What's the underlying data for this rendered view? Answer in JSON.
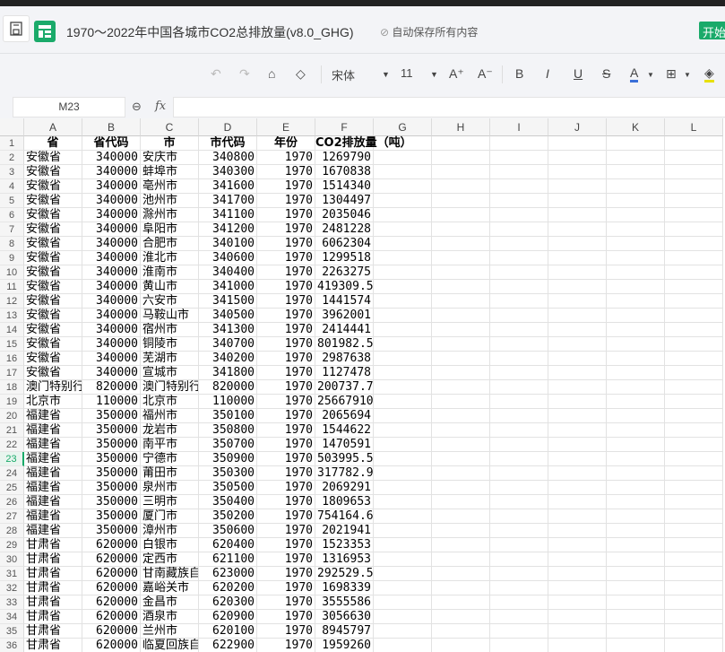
{
  "app": {
    "title": "1970～2022年中国各城市CO2总排放量(v8.0_GHG)",
    "autosave": "自动保存所有内容",
    "start_button": "开始",
    "accent": "#1aaa6a"
  },
  "toolbar": {
    "font_name": "宋体",
    "font_size": "11",
    "bold": "B",
    "italic": "I",
    "underline": "U",
    "strike": "S",
    "font_color": "A",
    "increase_font": "A⁺",
    "decrease_font": "A⁻"
  },
  "formula_bar": {
    "cell_ref": "M23",
    "fx": "fx",
    "value": ""
  },
  "sheet": {
    "columns": [
      "A",
      "B",
      "C",
      "D",
      "E",
      "F",
      "G",
      "H",
      "I",
      "J",
      "K",
      "L"
    ],
    "selected_row": 23,
    "header": [
      "省",
      "省代码",
      "市",
      "市代码",
      "年份",
      "CO2排放量（吨）"
    ],
    "rows": [
      [
        "安徽省",
        "340000",
        "安庆市",
        "340800",
        "1970",
        "1269790"
      ],
      [
        "安徽省",
        "340000",
        "蚌埠市",
        "340300",
        "1970",
        "1670838"
      ],
      [
        "安徽省",
        "340000",
        "亳州市",
        "341600",
        "1970",
        "1514340"
      ],
      [
        "安徽省",
        "340000",
        "池州市",
        "341700",
        "1970",
        "1304497"
      ],
      [
        "安徽省",
        "340000",
        "滁州市",
        "341100",
        "1970",
        "2035046"
      ],
      [
        "安徽省",
        "340000",
        "阜阳市",
        "341200",
        "1970",
        "2481228"
      ],
      [
        "安徽省",
        "340000",
        "合肥市",
        "340100",
        "1970",
        "6062304"
      ],
      [
        "安徽省",
        "340000",
        "淮北市",
        "340600",
        "1970",
        "1299518"
      ],
      [
        "安徽省",
        "340000",
        "淮南市",
        "340400",
        "1970",
        "2263275"
      ],
      [
        "安徽省",
        "340000",
        "黄山市",
        "341000",
        "1970",
        "419309.5"
      ],
      [
        "安徽省",
        "340000",
        "六安市",
        "341500",
        "1970",
        "1441574"
      ],
      [
        "安徽省",
        "340000",
        "马鞍山市",
        "340500",
        "1970",
        "3962001"
      ],
      [
        "安徽省",
        "340000",
        "宿州市",
        "341300",
        "1970",
        "2414441"
      ],
      [
        "安徽省",
        "340000",
        "铜陵市",
        "340700",
        "1970",
        "801982.5"
      ],
      [
        "安徽省",
        "340000",
        "芜湖市",
        "340200",
        "1970",
        "2987638"
      ],
      [
        "安徽省",
        "340000",
        "宣城市",
        "341800",
        "1970",
        "1127478"
      ],
      [
        "澳门特别行",
        "820000",
        "澳门特别行",
        "820000",
        "1970",
        "200737.7"
      ],
      [
        "北京市",
        "110000",
        "北京市",
        "110000",
        "1970",
        "25667910"
      ],
      [
        "福建省",
        "350000",
        "福州市",
        "350100",
        "1970",
        "2065694"
      ],
      [
        "福建省",
        "350000",
        "龙岩市",
        "350800",
        "1970",
        "1544622"
      ],
      [
        "福建省",
        "350000",
        "南平市",
        "350700",
        "1970",
        "1470591"
      ],
      [
        "福建省",
        "350000",
        "宁德市",
        "350900",
        "1970",
        "503995.5"
      ],
      [
        "福建省",
        "350000",
        "莆田市",
        "350300",
        "1970",
        "317782.9"
      ],
      [
        "福建省",
        "350000",
        "泉州市",
        "350500",
        "1970",
        "2069291"
      ],
      [
        "福建省",
        "350000",
        "三明市",
        "350400",
        "1970",
        "1809653"
      ],
      [
        "福建省",
        "350000",
        "厦门市",
        "350200",
        "1970",
        "754164.6"
      ],
      [
        "福建省",
        "350000",
        "漳州市",
        "350600",
        "1970",
        "2021941"
      ],
      [
        "甘肃省",
        "620000",
        "白银市",
        "620400",
        "1970",
        "1523353"
      ],
      [
        "甘肃省",
        "620000",
        "定西市",
        "621100",
        "1970",
        "1316953"
      ],
      [
        "甘肃省",
        "620000",
        "甘南藏族自",
        "623000",
        "1970",
        "292529.5"
      ],
      [
        "甘肃省",
        "620000",
        "嘉峪关市",
        "620200",
        "1970",
        "1698339"
      ],
      [
        "甘肃省",
        "620000",
        "金昌市",
        "620300",
        "1970",
        "3555586"
      ],
      [
        "甘肃省",
        "620000",
        "酒泉市",
        "620900",
        "1970",
        "3056630"
      ],
      [
        "甘肃省",
        "620000",
        "兰州市",
        "620100",
        "1970",
        "8945797"
      ],
      [
        "甘肃省",
        "620000",
        "临夏回族自",
        "622900",
        "1970",
        "1959260"
      ]
    ]
  }
}
